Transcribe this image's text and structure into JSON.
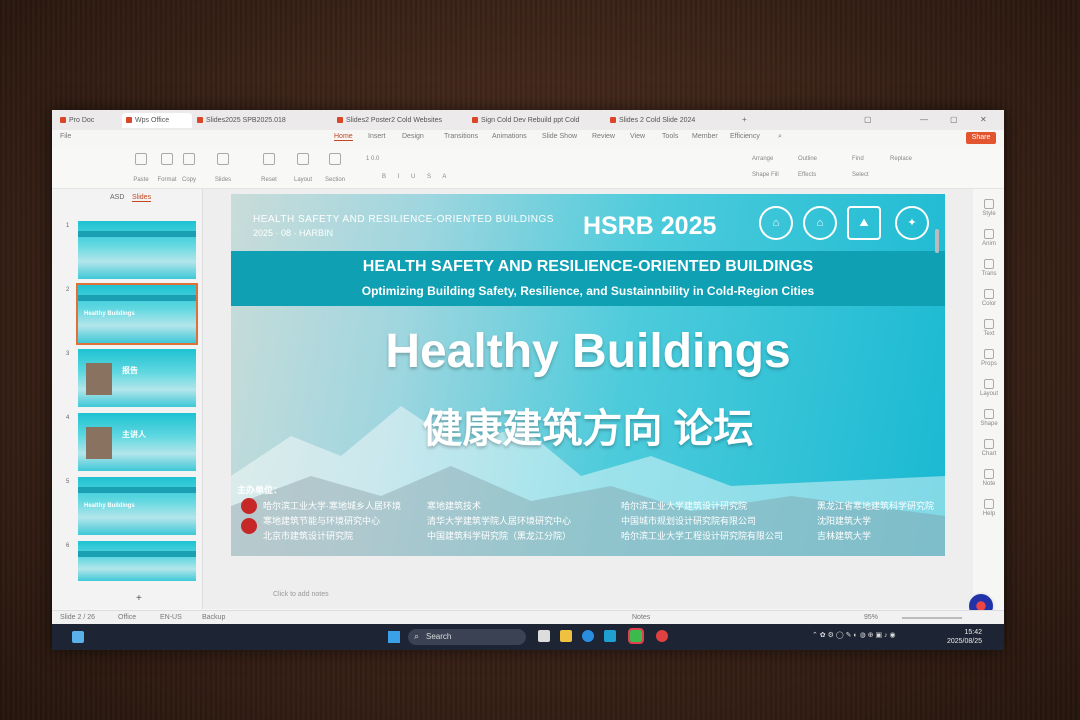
{
  "tabs": [
    {
      "label": "Pro Doc"
    },
    {
      "label": "Wps Office"
    },
    {
      "label": "Slides2025 SPB2025.018"
    },
    {
      "label": "Slides2 Poster2 Cold Websites"
    },
    {
      "label": "Sign Cold Dev Rebuild ppt Cold"
    },
    {
      "label": "Slides 2 Cold Slide 2024"
    }
  ],
  "menubar": {
    "file": "File",
    "items": [
      "Home",
      "Insert",
      "Design",
      "Transitions",
      "Animations",
      "Slide Show",
      "Review",
      "View",
      "Tools",
      "Member",
      "Efficiency",
      "AI"
    ],
    "active_index": 0,
    "share": "Share"
  },
  "ribbon": {
    "buttons": [
      "Paste",
      "Format",
      "Copy",
      "Slides",
      "Reset",
      "Layout",
      "Section",
      "Font"
    ],
    "font_size": "1 0.0",
    "arrange": "Arrange",
    "find": "Find",
    "replace": "Replace",
    "select": "Select",
    "shape_fill": "Shape Fill",
    "outline": "Outline",
    "effects": "Effects"
  },
  "left_panel": {
    "tab_outline": "ASD",
    "tab_slides": "Slides",
    "thumb_title_2": "Healthy Buildings",
    "thumb_cn_3": "报告",
    "thumb_cn_4": "主讲人",
    "thumb_title_5": "Healthy Buildings",
    "add": "+"
  },
  "slide": {
    "topline": "HEALTH SAFETY AND RESILIENCE-ORIENTED BUILDINGS",
    "dateline": "2025 · 08 · HARBIN",
    "hsrb": "HSRB 2025",
    "band_title": "HEALTH SAFETY AND RESILIENCE-ORIENTED BUILDINGS",
    "band_subtitle": "Optimizing Building Safety, Resilience, and Sustainnbility in Cold-Region Cities",
    "main_title": "Healthy Buildings",
    "cn_title": "健康建筑方向 论坛",
    "organizers_label": "主办单位：",
    "organizers": [
      "哈尔滨工业大学·寒地城乡人居环境",
      "寒地建筑节能与环境研究中心",
      "北京市建筑设计研究院",
      "寒地建筑技术",
      "清华大学建筑学院人居环境研究中心",
      "中国建筑科学研究院（黑龙江分院）",
      "哈尔滨工业大学建筑设计研究院",
      "中国城市规划设计研究院有限公司",
      "哈尔滨工业大学工程设计研究院有限公司",
      "黑龙江省寒地建筑科学研究院",
      "沈阳建筑大学",
      "吉林建筑大学"
    ]
  },
  "canvas_note": "Click to add notes",
  "right_panel": [
    "Style",
    "Anim",
    "Trans",
    "Color",
    "Text",
    "Props",
    "Layout",
    "Shape",
    "Chart",
    "Note",
    "Help"
  ],
  "statusbar": {
    "slide_info": "Slide 2 / 26",
    "theme": "Office",
    "lang": "EN-US",
    "backup": "Backup",
    "zoom": "95%",
    "notes": "Notes"
  },
  "taskbar": {
    "search": "Search",
    "clock_time": "15:42",
    "clock_date": "2025/08/25"
  }
}
